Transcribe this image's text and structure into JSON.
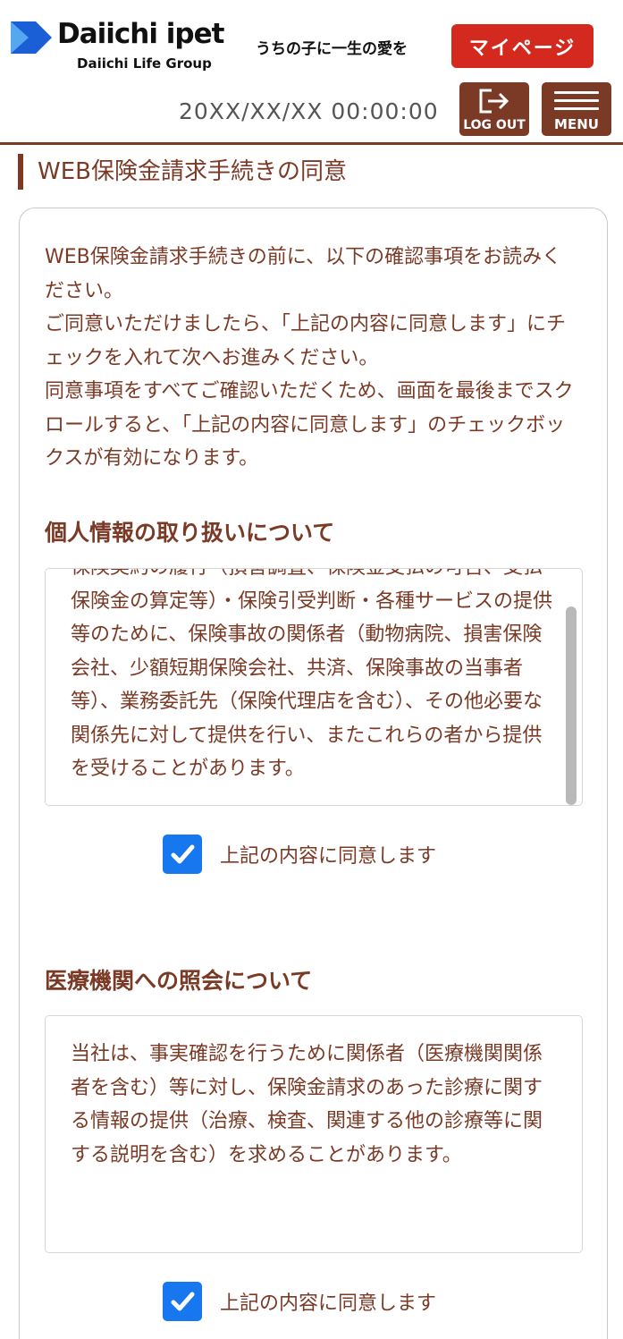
{
  "header": {
    "logo_text": "Daiichi ipet",
    "logo_subtext": "Daiichi Life Group",
    "tagline": "うちの子に一生の愛を",
    "mypage_label": "マイページ",
    "datetime": "20XX/XX/XX 00:00:00",
    "logout_label": "LOG OUT",
    "menu_label": "MENU"
  },
  "page": {
    "title": "WEB保険金請求手続きの同意"
  },
  "intro": {
    "text": "WEB保険金請求手続きの前に、以下の確認事項をお読みください。\nご同意いただけましたら、「上記の内容に同意します」にチェックを入れて次へお進みください。\n同意事項をすべてご確認いただくため、画面を最後までスクロールすると、「上記の内容に同意します」のチェックボックスが有効になります。"
  },
  "sections": [
    {
      "heading": "個人情報の取り扱いについて",
      "body": "保険契約の履行（損害調査、保険金支払の可否、支払保険金の算定等）・保険引受判断・各種サービスの提供等のために、保険事故の関係者（動物病院、損害保険会社、少額短期保険会社、共済、保険事故の当事者等）、業務委託先（保険代理店を含む）、その他必要な関係先に対して提供を行い、またこれらの者から提供を受けることがあります。",
      "agree_label": "上記の内容に同意します",
      "agreed": true
    },
    {
      "heading": "医療機関への照会について",
      "body": "当社は、事実確認を行うために関係者（医療機関関係者を含む）等に対し、保険金請求のあった診療に関する情報の提供（治療、検査、関連する他の診療等に関する説明を含む）を求めることがあります。",
      "agree_label": "上記の内容に同意します",
      "agreed": true
    }
  ],
  "colors": {
    "brand_brown": "#7a3a26",
    "mypage_red": "#d4291f",
    "checkbox_blue": "#1677ee",
    "logo_blue": "#1a5fd6"
  }
}
